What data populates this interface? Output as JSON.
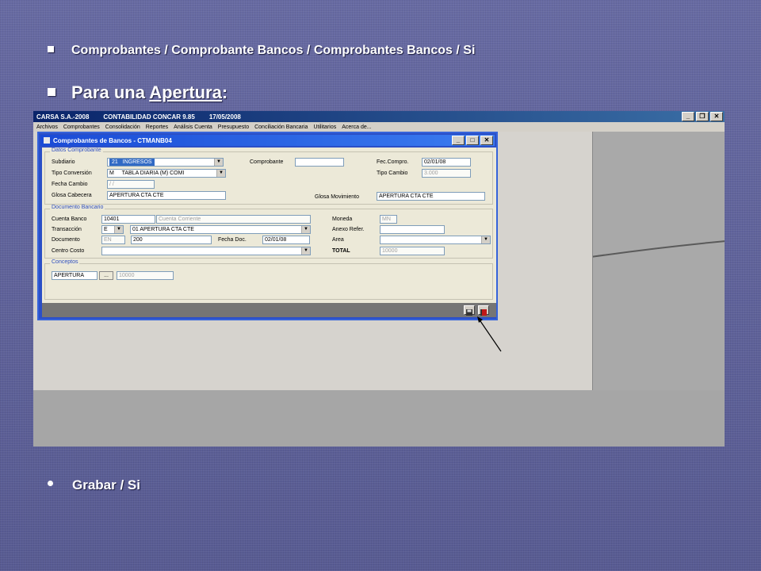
{
  "slide": {
    "line1": "Comprobantes / Comprobante Bancos / Comprobantes Bancos / Si",
    "line2_prefix": "Para una ",
    "line2_link": "Apertura",
    "line2_suffix": ":",
    "line3": "Grabar / Si"
  },
  "app": {
    "company": "CARSA S.A.-2008",
    "product": "CONTABILIDAD CONCAR 9.85",
    "date": "17/05/2008",
    "menu": [
      "Archivos",
      "Comprobantes",
      "Consolidación",
      "Reportes",
      "Análisis Cuenta",
      "Presupuesto",
      "Conciliación Bancaria",
      "Utilitarios",
      "Acerca de..."
    ]
  },
  "dialog": {
    "title": "Comprobantes de Bancos - CTMANB04",
    "datos": {
      "group_label": "Datos Comprobante",
      "subdiario_label": "Subdiario",
      "subdiario_code": "21",
      "subdiario_name": "INGRESOS",
      "comprobante_label": "Comprobante",
      "comprobante_value": "",
      "fec_compro_label": "Fec.Compro.",
      "fec_compro_value": "02/01/08",
      "tipo_conversion_label": "Tipo Conversión",
      "tipo_conversion_code": "M",
      "tipo_conversion_name": "TABLA DIARIA (M) COMI",
      "tipo_cambio_label": "Tipo Cambio",
      "tipo_cambio_value": "3.000",
      "fecha_cambio_label": "Fecha Cambio",
      "fecha_cambio_value": " /  /",
      "glosa_cabecera_label": "Glosa Cabecera",
      "glosa_cabecera_value": "APERTURA CTA CTE",
      "glosa_movimiento_label": "Glosa Movimiento",
      "glosa_movimiento_value": "APERTURA CTA CTE"
    },
    "documento": {
      "group_label": "Documento Bancario",
      "cuenta_banco_label": "Cuenta Banco",
      "cuenta_banco_value": "10401",
      "cuenta_banco_desc": "Cuenta Corriente",
      "moneda_label": "Moneda",
      "moneda_value": "MN",
      "transaccion_label": "Transacción",
      "transaccion_code": "E",
      "transaccion_value": "01   APERTURA CTA CTE",
      "anexo_label": "Anexo Refer.",
      "anexo_value": "",
      "documento_label": "Documento",
      "documento_type": "EN",
      "documento_value": "200",
      "fecha_doc_label": "Fecha Doc.",
      "fecha_doc_value": "02/01/08",
      "area_label": "Area",
      "area_value": "",
      "centro_costo_label": "Centro Costo",
      "centro_costo_value": "",
      "total_label": "TOTAL",
      "total_value": "10000"
    },
    "conceptos": {
      "group_label": "Conceptos",
      "concepto_value": "APERTURA",
      "ellipsis_label": "...",
      "monto_value": "10000"
    }
  }
}
